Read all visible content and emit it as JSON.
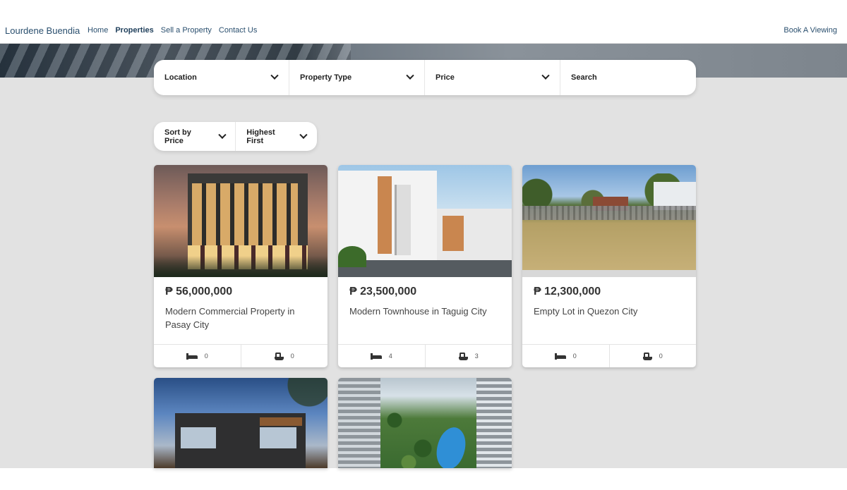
{
  "nav": {
    "brand": "Lourdene Buendia",
    "links": [
      "Home",
      "Properties",
      "Sell a Property",
      "Contact Us"
    ],
    "active": "Properties",
    "cta": "Book A Viewing"
  },
  "search": {
    "location": "Location",
    "property_type": "Property Type",
    "price": "Price",
    "search": "Search"
  },
  "sort": {
    "sort_by": "Sort by Price",
    "order": "Highest First"
  },
  "listings": [
    {
      "price": "₱ 56,000,000",
      "title": "Modern Commercial Property in Pasay City",
      "beds": "0",
      "baths": "0"
    },
    {
      "price": "₱ 23,500,000",
      "title": "Modern Townhouse in Taguig City",
      "beds": "4",
      "baths": "3"
    },
    {
      "price": "₱ 12,300,000",
      "title": "Empty Lot in Quezon City",
      "beds": "0",
      "baths": "0"
    },
    {
      "price": "",
      "title": "",
      "beds": "",
      "baths": ""
    },
    {
      "price": "",
      "title": "",
      "beds": "",
      "baths": ""
    }
  ],
  "icons": {
    "bed": "bed-icon",
    "bath": "bathtub-icon",
    "dropdown": "chevron-down-icon"
  }
}
